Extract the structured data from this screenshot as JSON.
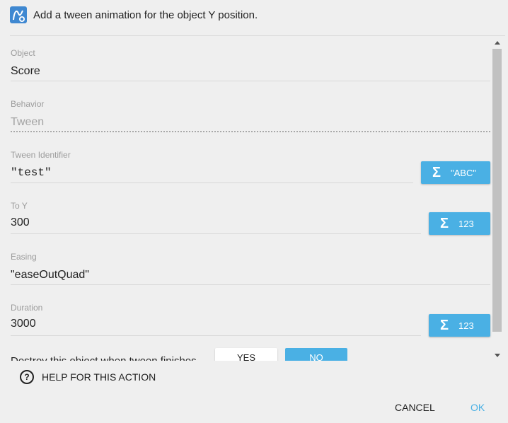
{
  "header": {
    "title": "Add a tween animation for the object Y position.",
    "icon": "tween-icon",
    "accent_color": "#3f88d1"
  },
  "fields": {
    "object": {
      "label": "Object",
      "value": "Score"
    },
    "behavior": {
      "label": "Behavior",
      "value": "Tween"
    },
    "tween_identifier": {
      "label": "Tween Identifier",
      "value": "\"test\"",
      "button_label": "\"ABC\""
    },
    "to_y": {
      "label": "To Y",
      "value": "300",
      "button_label": "123"
    },
    "easing": {
      "label": "Easing",
      "value": "\"easeOutQuad\""
    },
    "duration": {
      "label": "Duration",
      "value": "3000",
      "button_label": "123"
    }
  },
  "destroy": {
    "label": "Destroy this object when tween finishes",
    "yes_label": "YES",
    "no_label": "NO",
    "selected": "NO"
  },
  "expression_icon": "sigma-icon",
  "help": {
    "label": "HELP FOR THIS ACTION",
    "icon": "help-icon"
  },
  "actions": {
    "cancel_label": "CANCEL",
    "ok_label": "OK"
  },
  "colors": {
    "button_blue": "#4ab0e4",
    "background": "#efefef"
  }
}
